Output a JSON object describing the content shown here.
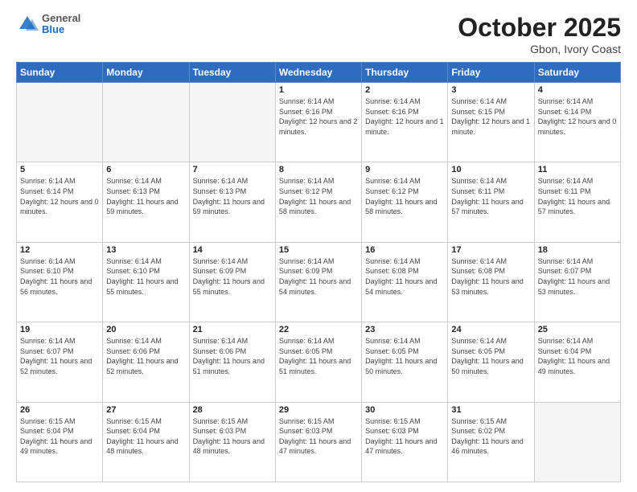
{
  "header": {
    "logo_general": "General",
    "logo_blue": "Blue",
    "title": "October 2025",
    "location": "Gbon, Ivory Coast"
  },
  "weekdays": [
    "Sunday",
    "Monday",
    "Tuesday",
    "Wednesday",
    "Thursday",
    "Friday",
    "Saturday"
  ],
  "weeks": [
    [
      {
        "day": "",
        "info": ""
      },
      {
        "day": "",
        "info": ""
      },
      {
        "day": "",
        "info": ""
      },
      {
        "day": "1",
        "info": "Sunrise: 6:14 AM\nSunset: 6:16 PM\nDaylight: 12 hours and 2 minutes."
      },
      {
        "day": "2",
        "info": "Sunrise: 6:14 AM\nSunset: 6:16 PM\nDaylight: 12 hours and 1 minute."
      },
      {
        "day": "3",
        "info": "Sunrise: 6:14 AM\nSunset: 6:15 PM\nDaylight: 12 hours and 1 minute."
      },
      {
        "day": "4",
        "info": "Sunrise: 6:14 AM\nSunset: 6:14 PM\nDaylight: 12 hours and 0 minutes."
      }
    ],
    [
      {
        "day": "5",
        "info": "Sunrise: 6:14 AM\nSunset: 6:14 PM\nDaylight: 12 hours and 0 minutes."
      },
      {
        "day": "6",
        "info": "Sunrise: 6:14 AM\nSunset: 6:13 PM\nDaylight: 11 hours and 59 minutes."
      },
      {
        "day": "7",
        "info": "Sunrise: 6:14 AM\nSunset: 6:13 PM\nDaylight: 11 hours and 59 minutes."
      },
      {
        "day": "8",
        "info": "Sunrise: 6:14 AM\nSunset: 6:12 PM\nDaylight: 11 hours and 58 minutes."
      },
      {
        "day": "9",
        "info": "Sunrise: 6:14 AM\nSunset: 6:12 PM\nDaylight: 11 hours and 58 minutes."
      },
      {
        "day": "10",
        "info": "Sunrise: 6:14 AM\nSunset: 6:11 PM\nDaylight: 11 hours and 57 minutes."
      },
      {
        "day": "11",
        "info": "Sunrise: 6:14 AM\nSunset: 6:11 PM\nDaylight: 11 hours and 57 minutes."
      }
    ],
    [
      {
        "day": "12",
        "info": "Sunrise: 6:14 AM\nSunset: 6:10 PM\nDaylight: 11 hours and 56 minutes."
      },
      {
        "day": "13",
        "info": "Sunrise: 6:14 AM\nSunset: 6:10 PM\nDaylight: 11 hours and 55 minutes."
      },
      {
        "day": "14",
        "info": "Sunrise: 6:14 AM\nSunset: 6:09 PM\nDaylight: 11 hours and 55 minutes."
      },
      {
        "day": "15",
        "info": "Sunrise: 6:14 AM\nSunset: 6:09 PM\nDaylight: 11 hours and 54 minutes."
      },
      {
        "day": "16",
        "info": "Sunrise: 6:14 AM\nSunset: 6:08 PM\nDaylight: 11 hours and 54 minutes."
      },
      {
        "day": "17",
        "info": "Sunrise: 6:14 AM\nSunset: 6:08 PM\nDaylight: 11 hours and 53 minutes."
      },
      {
        "day": "18",
        "info": "Sunrise: 6:14 AM\nSunset: 6:07 PM\nDaylight: 11 hours and 53 minutes."
      }
    ],
    [
      {
        "day": "19",
        "info": "Sunrise: 6:14 AM\nSunset: 6:07 PM\nDaylight: 11 hours and 52 minutes."
      },
      {
        "day": "20",
        "info": "Sunrise: 6:14 AM\nSunset: 6:06 PM\nDaylight: 11 hours and 52 minutes."
      },
      {
        "day": "21",
        "info": "Sunrise: 6:14 AM\nSunset: 6:06 PM\nDaylight: 11 hours and 51 minutes."
      },
      {
        "day": "22",
        "info": "Sunrise: 6:14 AM\nSunset: 6:05 PM\nDaylight: 11 hours and 51 minutes."
      },
      {
        "day": "23",
        "info": "Sunrise: 6:14 AM\nSunset: 6:05 PM\nDaylight: 11 hours and 50 minutes."
      },
      {
        "day": "24",
        "info": "Sunrise: 6:14 AM\nSunset: 6:05 PM\nDaylight: 11 hours and 50 minutes."
      },
      {
        "day": "25",
        "info": "Sunrise: 6:14 AM\nSunset: 6:04 PM\nDaylight: 11 hours and 49 minutes."
      }
    ],
    [
      {
        "day": "26",
        "info": "Sunrise: 6:15 AM\nSunset: 6:04 PM\nDaylight: 11 hours and 49 minutes."
      },
      {
        "day": "27",
        "info": "Sunrise: 6:15 AM\nSunset: 6:04 PM\nDaylight: 11 hours and 48 minutes."
      },
      {
        "day": "28",
        "info": "Sunrise: 6:15 AM\nSunset: 6:03 PM\nDaylight: 11 hours and 48 minutes."
      },
      {
        "day": "29",
        "info": "Sunrise: 6:15 AM\nSunset: 6:03 PM\nDaylight: 11 hours and 47 minutes."
      },
      {
        "day": "30",
        "info": "Sunrise: 6:15 AM\nSunset: 6:03 PM\nDaylight: 11 hours and 47 minutes."
      },
      {
        "day": "31",
        "info": "Sunrise: 6:15 AM\nSunset: 6:02 PM\nDaylight: 11 hours and 46 minutes."
      },
      {
        "day": "",
        "info": ""
      }
    ]
  ]
}
